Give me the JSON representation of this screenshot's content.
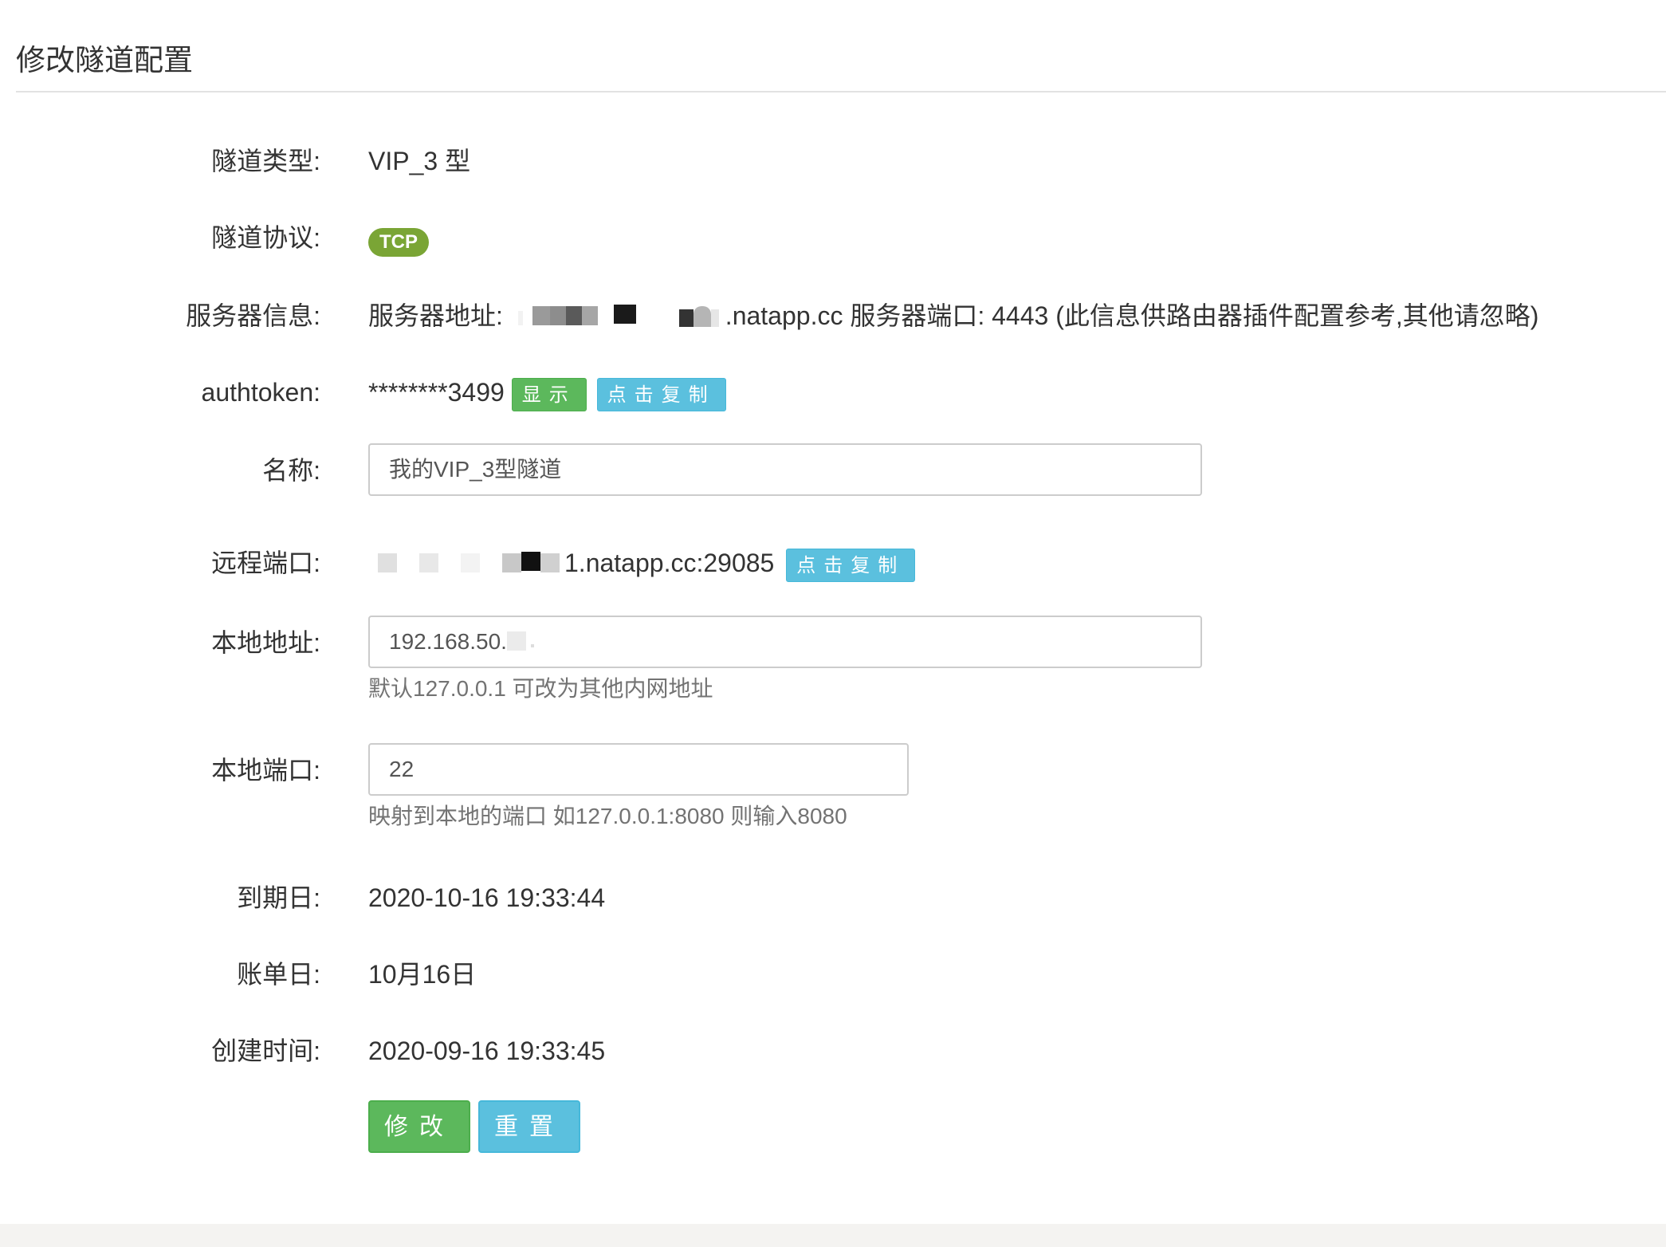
{
  "page": {
    "title": "修改隧道配置"
  },
  "form": {
    "type": {
      "label": "隧道类型:",
      "value": "VIP_3 型"
    },
    "protocol": {
      "label": "隧道协议:",
      "badge": "TCP",
      "badge_color": "#7aa535"
    },
    "server": {
      "label": "服务器信息:",
      "prefix": "服务器地址:",
      "suffix": ".natapp.cc 服务器端口: 4443 (此信息供路由器插件配置参考,其他请忽略)"
    },
    "authtoken": {
      "label": "authtoken:",
      "value": "********3499",
      "show_button": "显示",
      "copy_button": "点击复制"
    },
    "name": {
      "label": "名称:",
      "value": "我的VIP_3型隧道"
    },
    "remote_port": {
      "label": "远程端口:",
      "suffix": "1.natapp.cc:29085",
      "copy_button": "点击复制"
    },
    "local_address": {
      "label": "本地地址:",
      "value": "192.168.50.",
      "help": "默认127.0.0.1 可改为其他内网地址"
    },
    "local_port": {
      "label": "本地端口:",
      "value": "22",
      "help": "映射到本地的端口 如127.0.0.1:8080 则输入8080"
    },
    "expire": {
      "label": "到期日:",
      "value": "2020-10-16 19:33:44"
    },
    "billing": {
      "label": "账单日:",
      "value": "10月16日"
    },
    "created": {
      "label": "创建时间:",
      "value": "2020-09-16 19:33:45"
    }
  },
  "actions": {
    "submit": "修改",
    "reset": "重置"
  },
  "colors": {
    "success": "#5cb85c",
    "info": "#5bc0de",
    "badge": "#7aa535"
  }
}
